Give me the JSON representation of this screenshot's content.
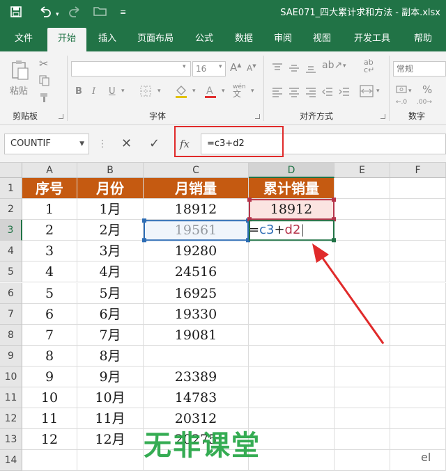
{
  "titlebar": {
    "title": "SAE071_四大累计求和方法 - 副本.xlsx",
    "icons": [
      "save-icon",
      "undo-icon",
      "redo-icon",
      "open-folder-icon",
      "customize-icon"
    ]
  },
  "tabs": [
    {
      "label": "文件"
    },
    {
      "label": "开始",
      "active": true
    },
    {
      "label": "插入"
    },
    {
      "label": "页面布局"
    },
    {
      "label": "公式"
    },
    {
      "label": "数据"
    },
    {
      "label": "审阅"
    },
    {
      "label": "视图"
    },
    {
      "label": "开发工具"
    },
    {
      "label": "帮助"
    }
  ],
  "ribbon": {
    "clipboard": {
      "paste_label": "粘贴",
      "group_label": "剪贴板"
    },
    "font": {
      "font_name": "",
      "font_size": "16",
      "bold": "B",
      "italic": "I",
      "underline": "U",
      "group_label": "字体"
    },
    "alignment": {
      "group_label": "对齐方式"
    },
    "number": {
      "format": "常规",
      "group_label": "数字"
    }
  },
  "formula_bar": {
    "name_box": "COUNTIF",
    "cancel": "✕",
    "enter": "✓",
    "fx": "fx",
    "formula": "=c3+d2"
  },
  "grid": {
    "columns": [
      "A",
      "B",
      "C",
      "D",
      "E",
      "F"
    ],
    "selected_column": "D",
    "rows": [
      "1",
      "2",
      "3",
      "4",
      "5",
      "6",
      "7",
      "8",
      "9",
      "10",
      "11",
      "12",
      "13",
      "14"
    ],
    "selected_row": "3",
    "header": [
      "序号",
      "月份",
      "月销量",
      "累计销量"
    ],
    "data": [
      [
        "1",
        "1月",
        "18912",
        "18912"
      ],
      [
        "2",
        "2月",
        "19561",
        "=c3+d2"
      ],
      [
        "3",
        "3月",
        "19280",
        ""
      ],
      [
        "4",
        "4月",
        "24516",
        ""
      ],
      [
        "5",
        "5月",
        "16925",
        ""
      ],
      [
        "6",
        "6月",
        "19330",
        ""
      ],
      [
        "7",
        "7月",
        "19081",
        ""
      ],
      [
        "8",
        "8月",
        "",
        ""
      ],
      [
        "9",
        "9月",
        "23389",
        ""
      ],
      [
        "10",
        "10月",
        "14783",
        ""
      ],
      [
        "11",
        "11月",
        "20312",
        ""
      ],
      [
        "12",
        "12月",
        "20275",
        ""
      ]
    ],
    "editing_formula": {
      "prefix": "=",
      "ref1": "c3",
      "op": "+",
      "ref2": "d2"
    }
  },
  "colors": {
    "accent": "#217346",
    "header_fill": "#c55a11",
    "highlight_fill": "#fbe4e1",
    "ref1_color": "#2e6db5",
    "ref2_color": "#b5344a",
    "annotation": "#e02a2a"
  },
  "watermark": {
    "text": "无非课堂",
    "suffix": "el"
  }
}
